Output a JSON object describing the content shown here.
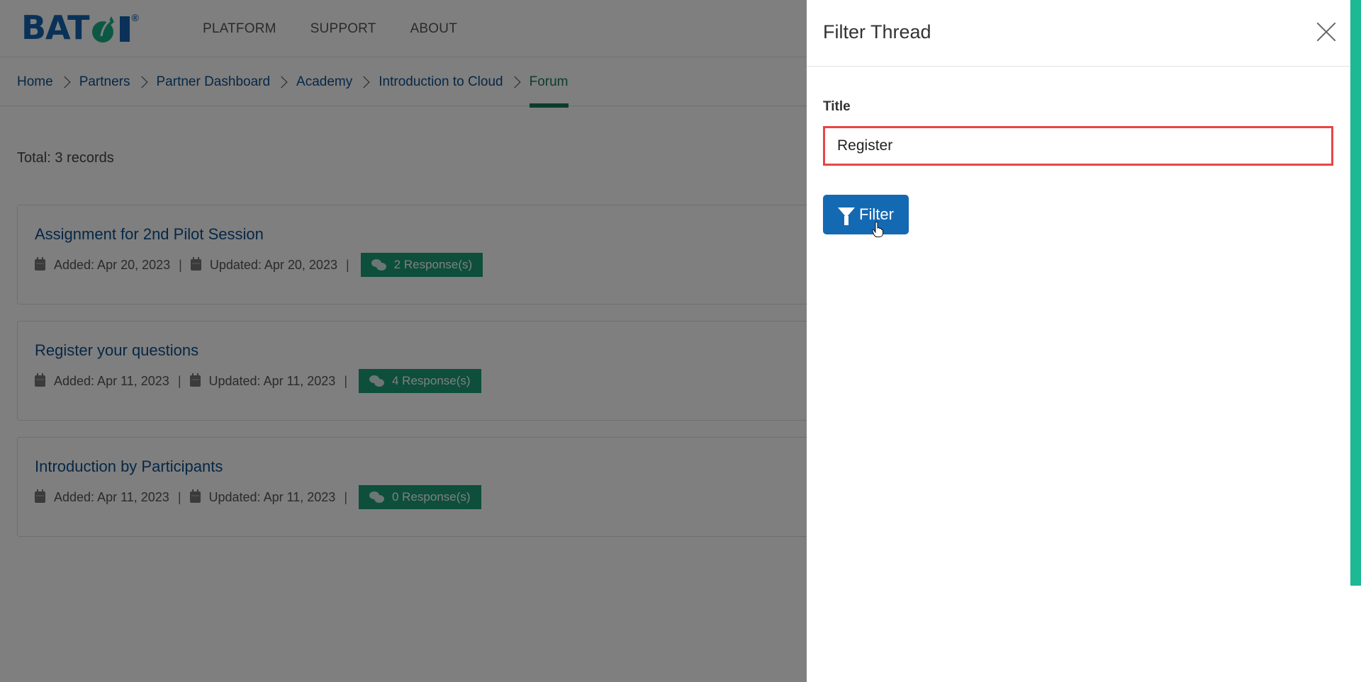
{
  "header": {
    "logo_text": "BATOI",
    "logo_registered": "®",
    "nav": [
      "PLATFORM",
      "SUPPORT",
      "ABOUT"
    ]
  },
  "breadcrumb": [
    "Home",
    "Partners",
    "Partner Dashboard",
    "Academy",
    "Introduction to Cloud",
    "Forum"
  ],
  "main": {
    "total": "Total: 3 records",
    "threads": [
      {
        "title": "Assignment for 2nd Pilot Session",
        "added": "Added: Apr 20, 2023",
        "updated": "Updated: Apr 20, 2023",
        "responses": "2 Response(s)"
      },
      {
        "title": "Register your questions",
        "added": "Added: Apr 11, 2023",
        "updated": "Updated: Apr 11, 2023",
        "responses": "4 Response(s)"
      },
      {
        "title": "Introduction by Participants",
        "added": "Added: Apr 11, 2023",
        "updated": "Updated: Apr 11, 2023",
        "responses": "0 Response(s)"
      }
    ]
  },
  "panel": {
    "title": "Filter Thread",
    "field_label": "Title",
    "title_value": "Register",
    "filter_button": "Filter"
  },
  "colors": {
    "brand_blue": "#1565b0",
    "brand_green": "#1a9e76",
    "accent_strip": "#1db894",
    "input_error_border": "#e84545",
    "button_blue": "#1469b3"
  }
}
